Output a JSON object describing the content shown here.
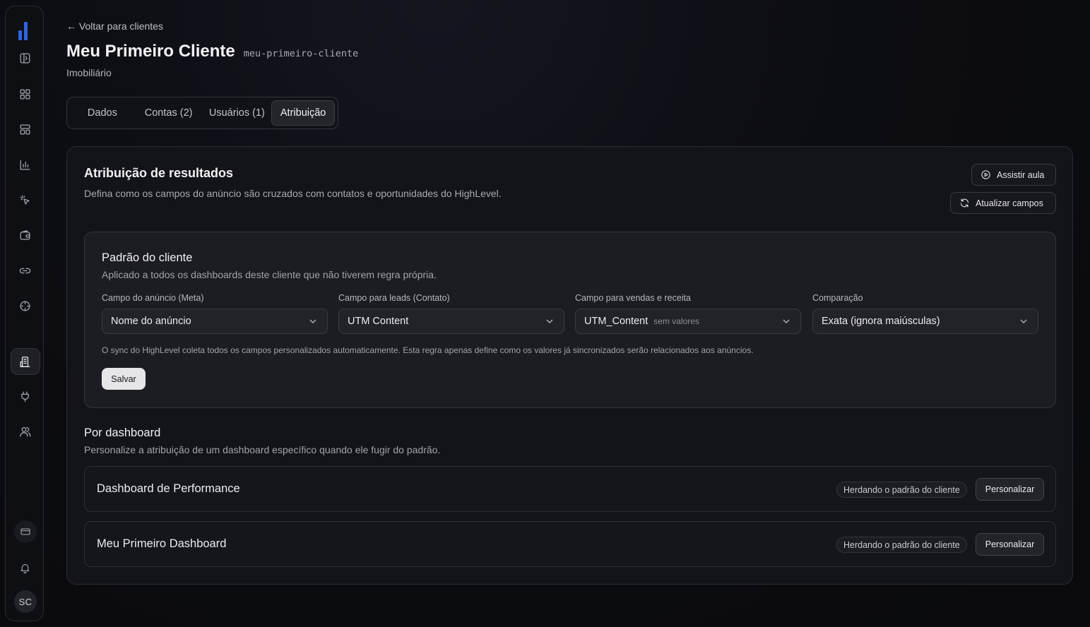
{
  "nav": {
    "back_label": "← Voltar para clientes",
    "icons": [
      "panel-icon",
      "grid-icon",
      "layout-icon",
      "bar-chart-icon",
      "click-icon",
      "wallet-icon",
      "link-icon",
      "target-icon",
      "building-icon",
      "plug-icon",
      "users-icon",
      "card-icon",
      "bell-icon"
    ],
    "avatar_initials": "SC",
    "accent": "#2f63e0"
  },
  "header": {
    "title": "Meu Primeiro Cliente",
    "slug": "meu-primeiro-cliente",
    "subtitle": "Imobiliário"
  },
  "tabs": [
    {
      "label": "Dados",
      "active": false
    },
    {
      "label": "Contas (2)",
      "active": false
    },
    {
      "label": "Usuários (1)",
      "active": false
    },
    {
      "label": "Atribuição",
      "active": true
    }
  ],
  "attribution": {
    "title": "Atribuição de resultados",
    "description": "Defina como os campos do anúncio são cruzados com contatos e oportunidades do HighLevel.",
    "watch_button": "Assistir aula",
    "refresh_button": "Atualizar campos"
  },
  "client_default": {
    "title": "Padrão do cliente",
    "description": "Aplicado a todos os dashboards deste cliente que não tiverem regra própria.",
    "fields": [
      {
        "label": "Campo do anúncio (Meta)",
        "value": "Nome do anúncio",
        "hint": ""
      },
      {
        "label": "Campo para leads (Contato)",
        "value": "UTM Content",
        "hint": ""
      },
      {
        "label": "Campo para vendas e receita",
        "value": "UTM_Content",
        "hint": "sem valores"
      },
      {
        "label": "Comparação",
        "value": "Exata (ignora maiúsculas)",
        "hint": ""
      }
    ],
    "note": "O sync do HighLevel coleta todos os campos personalizados automaticamente. Esta regra apenas define como os valores já sincronizados serão relacionados aos anúncios.",
    "save_label": "Salvar"
  },
  "per_dashboard": {
    "title": "Por dashboard",
    "description": "Personalize a atribuição de um dashboard específico quando ele fugir do padrão.",
    "rows": [
      {
        "name": "Dashboard de Performance",
        "badge": "Herdando o padrão do cliente",
        "button": "Personalizar"
      },
      {
        "name": "Meu Primeiro Dashboard",
        "badge": "Herdando o padrão do cliente",
        "button": "Personalizar"
      }
    ]
  }
}
